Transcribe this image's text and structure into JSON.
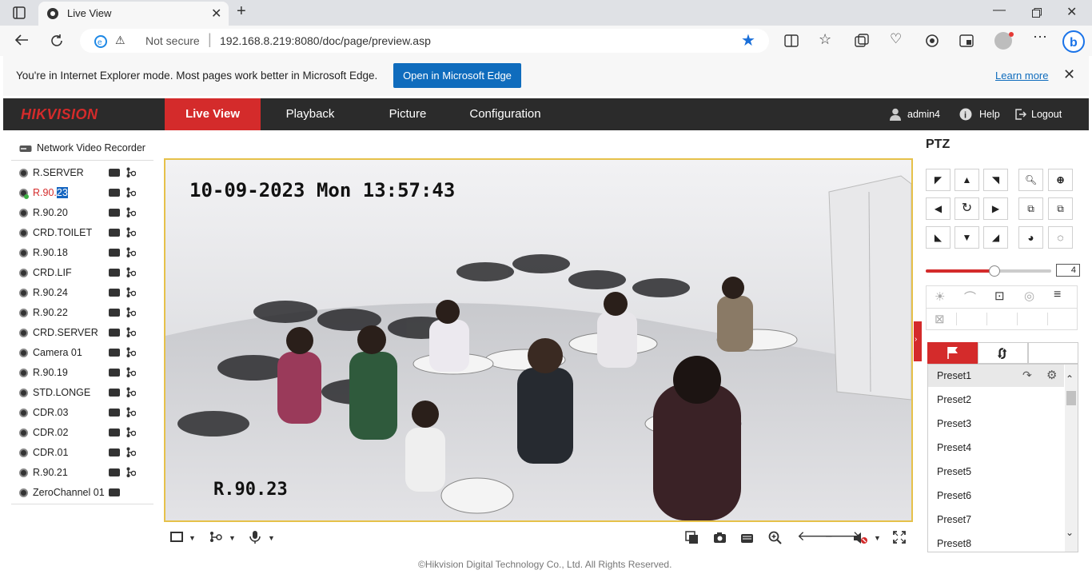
{
  "browser": {
    "tab_title": "Live View",
    "address_security": "Not secure",
    "url": "192.168.8.219:8080/doc/page/preview.asp",
    "ie_message": "You're in Internet Explorer mode. Most pages work better in Microsoft Edge.",
    "open_edge_label": "Open in Microsoft Edge",
    "learn_more_label": "Learn more"
  },
  "app": {
    "logo": "HIKVISION",
    "nav": [
      "Live View",
      "Playback",
      "Picture",
      "Configuration"
    ],
    "user": "admin4",
    "help": "Help",
    "logout": "Logout"
  },
  "tree": {
    "root": "Network Video Recorder",
    "selected_prefix": "R.90.",
    "selected_suffix": "23",
    "cameras": [
      "R.SERVER",
      "R.90.23",
      "R.90.20",
      "CRD.TOILET",
      "R.90.18",
      "CRD.LIF",
      "R.90.24",
      "R.90.22",
      "CRD.SERVER",
      "Camera 01",
      "R.90.19",
      "STD.LONGE",
      "CDR.03",
      "CDR.02",
      "CDR.01",
      "R.90.21",
      "ZeroChannel 01"
    ]
  },
  "video": {
    "timestamp": "10-09-2023 Mon 13:57:43",
    "channel_name": "R.90.23"
  },
  "ptz": {
    "title": "PTZ",
    "speed_value": "4",
    "speed_fraction": 0.55,
    "presets": [
      "Preset1",
      "Preset2",
      "Preset3",
      "Preset4",
      "Preset5",
      "Preset6",
      "Preset7",
      "Preset8"
    ]
  },
  "footer": "©Hikvision Digital Technology Co., Ltd. All Rights Reserved.",
  "colors": {
    "accent": "#d42b2b",
    "video_border": "#e6c14a",
    "edge_blue": "#0f6cbd"
  }
}
